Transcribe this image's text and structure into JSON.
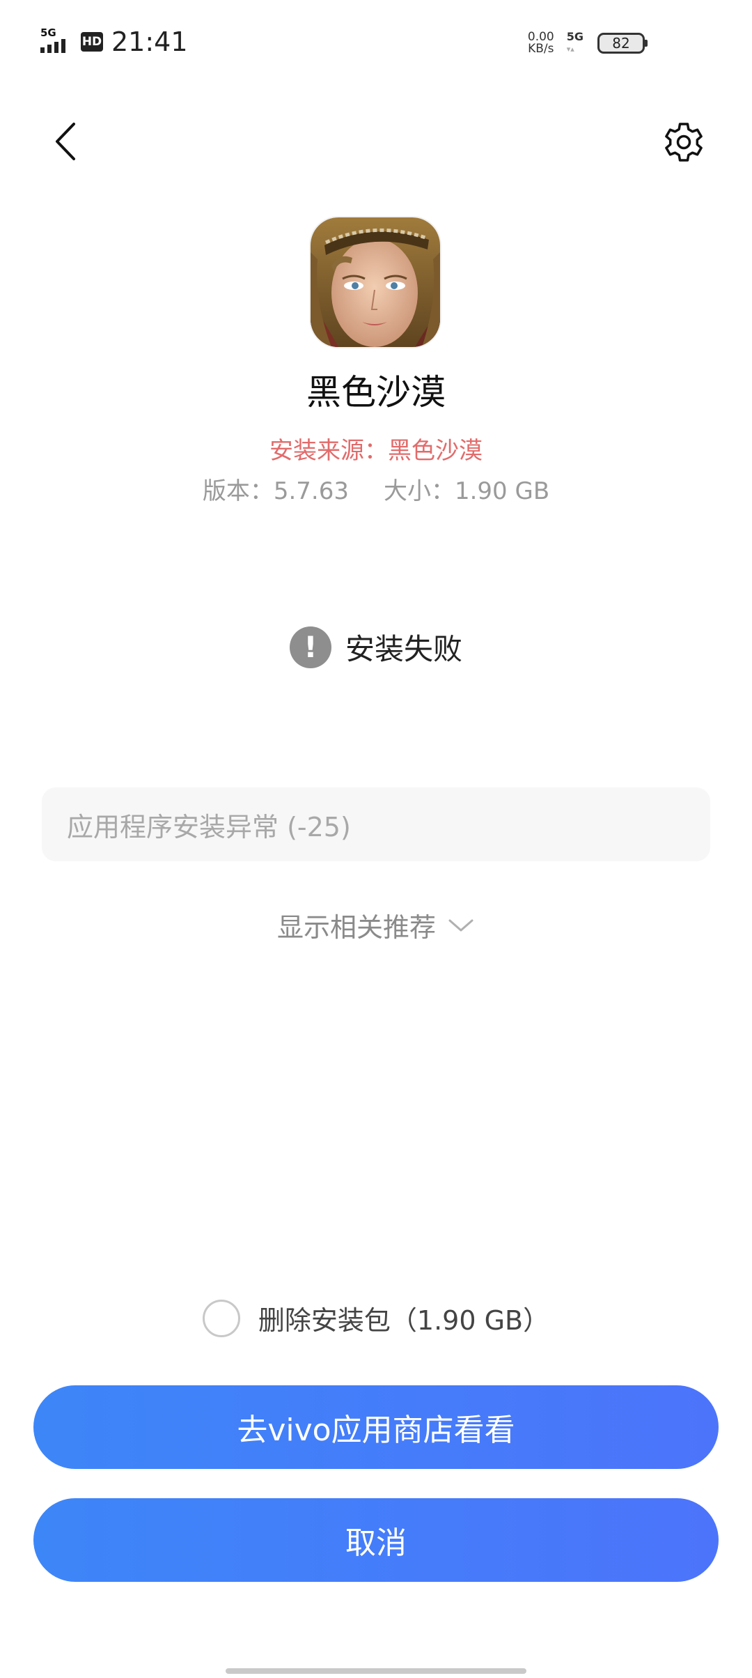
{
  "status_bar": {
    "network_tag": "5G",
    "hd_badge": "HD",
    "time": "21:41",
    "net_speed_value": "0.00",
    "net_speed_unit": "KB/s",
    "network_type": "5G",
    "battery_level": "82"
  },
  "app": {
    "name": "黑色沙漠",
    "install_source": "安装来源：黑色沙漠",
    "version": "版本：5.7.63",
    "size": "大小：1.90 GB"
  },
  "install_status": {
    "icon_symbol": "!",
    "text": "安装失败"
  },
  "error": {
    "message": "应用程序安装异常 (-25)"
  },
  "recommend": {
    "label": "显示相关推荐"
  },
  "delete_package": {
    "label": "删除安装包（1.90 GB）",
    "checked": false
  },
  "buttons": {
    "store": "去vivo应用商店看看",
    "cancel": "取消"
  },
  "colors": {
    "accent_start": "#3d86f8",
    "accent_end": "#4c74fb",
    "source_text": "#e26b6b"
  }
}
